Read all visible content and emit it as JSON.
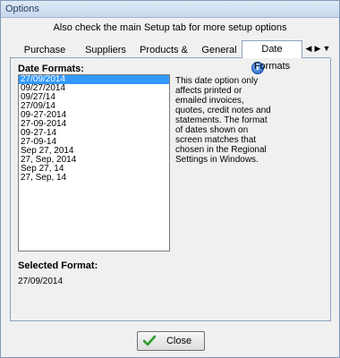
{
  "window": {
    "title": "Options"
  },
  "banner": "Also check the main Setup tab for more setup options",
  "tabs": [
    {
      "label": "Purchase Orders",
      "selected": false
    },
    {
      "label": "Suppliers",
      "selected": false
    },
    {
      "label": "Products & Stock",
      "selected": false
    },
    {
      "label": "General",
      "selected": false
    },
    {
      "label": "Date Formats",
      "selected": true
    }
  ],
  "tab_scroll": {
    "left_icon": "triangle-left-icon",
    "right_icon": "triangle-right-icon",
    "menu_icon": "triangle-down-icon"
  },
  "date_formats": {
    "label": "Date Formats:",
    "items": [
      "27/09/2014",
      "09/27/2014",
      "09/27/14",
      "27/09/14",
      "09-27-2014",
      "27-09-2014",
      "09-27-14",
      "27-09-14",
      "Sep 27, 2014",
      "27, Sep, 2014",
      "Sep 27, 14",
      "27, Sep, 14"
    ],
    "selected_index": 0
  },
  "description": "This date option only affects printed or emailed invoices, quotes, credit notes and statements. The format of dates shown on screen matches that chosen in the Regional Settings in Windows.",
  "info_icon": "info-icon",
  "selected_format": {
    "label": "Selected Format:",
    "value": "27/09/2014"
  },
  "close_button": {
    "label": "Close",
    "icon": "green-check-icon"
  },
  "colors": {
    "selection": "#3399ff",
    "title_text": "#1e395b",
    "check_green": "#2e9e2e"
  }
}
